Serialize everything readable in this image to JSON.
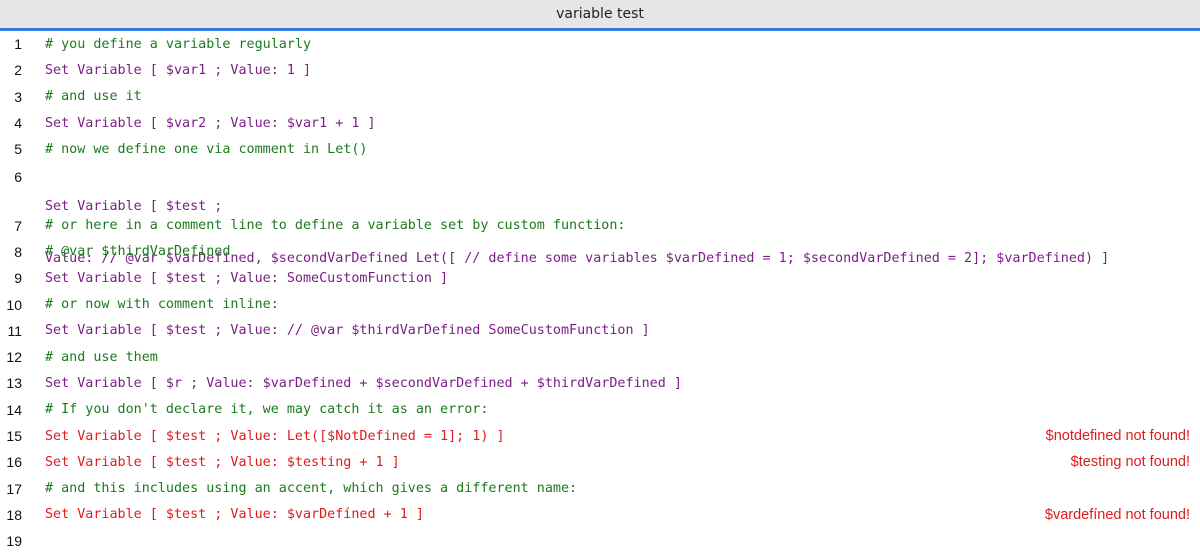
{
  "window": {
    "title": "variable test"
  },
  "lines": [
    {
      "n": "1",
      "kind": "comment",
      "text": "# you define a variable regularly"
    },
    {
      "n": "2",
      "kind": "step",
      "text": "Set Variable [ $var1 ; Value: 1 ]"
    },
    {
      "n": "3",
      "kind": "comment",
      "text": "# and use it"
    },
    {
      "n": "4",
      "kind": "step",
      "text": "Set Variable [ $var2 ; Value: $var1 + 1 ]"
    },
    {
      "n": "5",
      "kind": "comment",
      "text": "# now we define one via comment in Let()"
    },
    {
      "n": "6",
      "kind": "step",
      "text": "Set Variable [ $test ;",
      "text2": "Value: // @var $varDefined, $secondVarDefined Let([ // define some variables $varDefined = 1; $secondVarDefined = 2]; $varDefined) ]"
    },
    {
      "n": "7",
      "kind": "comment",
      "text": "# or here in a comment line to define a variable set by custom function:"
    },
    {
      "n": "8",
      "kind": "comment",
      "text": "# @var $thirdVarDefined"
    },
    {
      "n": "9",
      "kind": "step",
      "text": "Set Variable [ $test ; Value: SomeCustomFunction ]"
    },
    {
      "n": "10",
      "kind": "comment",
      "text": "# or now with comment inline:"
    },
    {
      "n": "11",
      "kind": "step",
      "text": "Set Variable [ $test ; Value: // @var $thirdVarDefined SomeCustomFunction ]"
    },
    {
      "n": "12",
      "kind": "comment",
      "text": "# and use them"
    },
    {
      "n": "13",
      "kind": "step",
      "text": "Set Variable [ $r ; Value: $varDefined + $secondVarDefined + $thirdVarDefined ]"
    },
    {
      "n": "14",
      "kind": "comment",
      "text": "# If you don't declare it, we may catch it as an error:"
    },
    {
      "n": "15",
      "kind": "error",
      "text": "Set Variable [ $test ; Value: Let([$NotDefined = 1]; 1) ]",
      "error": "$notdefined not found!"
    },
    {
      "n": "16",
      "kind": "error",
      "text": "Set Variable [ $test ; Value: $testing + 1 ]",
      "error": "$testing not found!"
    },
    {
      "n": "17",
      "kind": "comment",
      "text": "# and this includes using an accent, which gives a different name:"
    },
    {
      "n": "18",
      "kind": "error",
      "text": "Set Variable [ $test ; Value: $varDefíned + 1 ]",
      "error": "$vardefíned not found!"
    },
    {
      "n": "19",
      "kind": "empty",
      "text": ""
    }
  ],
  "colors": {
    "comment": "#1c7a1c",
    "step": "#7b1f86",
    "error": "#e01b1b",
    "accent": "#2f7fd8"
  }
}
